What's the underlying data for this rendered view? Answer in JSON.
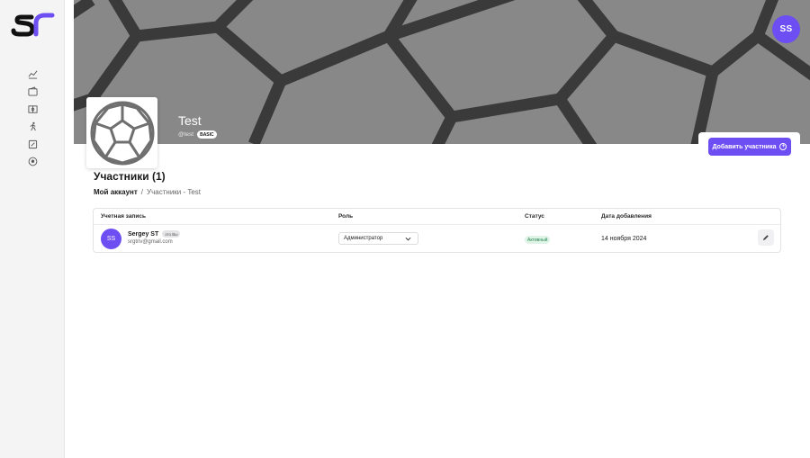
{
  "sidebar": {
    "logo_text": "ST",
    "items": [
      {
        "icon": "chart-icon"
      },
      {
        "icon": "wallet-icon"
      },
      {
        "icon": "field-icon"
      },
      {
        "icon": "runner-icon"
      },
      {
        "icon": "report-icon"
      },
      {
        "icon": "ball-icon"
      }
    ]
  },
  "header": {
    "user_initials": "SS"
  },
  "team": {
    "name": "Test",
    "handle": "@test",
    "plan": "BASIC",
    "add_member_label": "Добавить участника"
  },
  "page": {
    "title": "Участники (1)",
    "breadcrumb": {
      "root": "Мой аккаунт",
      "separator": "/",
      "current": "Участники - Test"
    }
  },
  "table": {
    "columns": [
      "Учетная запись",
      "Роль",
      "Статус",
      "Дата добавления"
    ],
    "rows": [
      {
        "initials": "SS",
        "name": "Sergey ST",
        "badge": "это Вы",
        "email": "srgtriv@gmail.com",
        "role": "Администратор",
        "status": "Активный",
        "date": "14 ноября 2024"
      }
    ]
  },
  "colors": {
    "accent": "#6c4ef2",
    "banner": "#888888",
    "status_bg": "#dff3e7",
    "status_text": "#2e8a55"
  }
}
